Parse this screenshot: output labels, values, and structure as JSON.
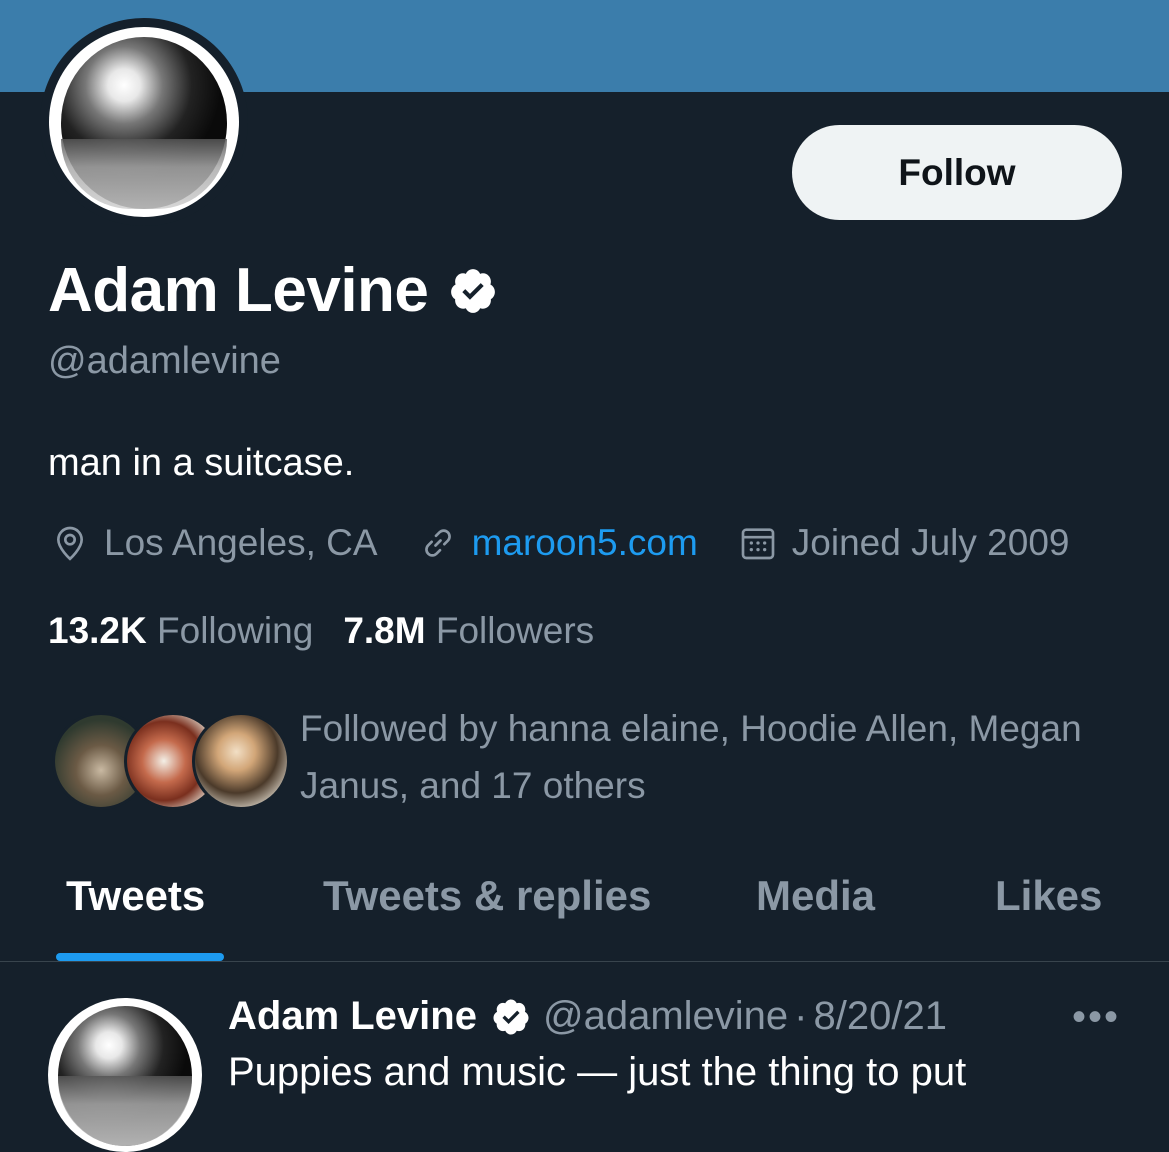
{
  "profile": {
    "name": "Adam Levine",
    "handle": "@adamlevine",
    "bio": "man in a suitcase.",
    "location": "Los Angeles, CA",
    "website": "maroon5.com",
    "joined": "Joined July 2009",
    "following_count": "13.2K",
    "following_label": "Following",
    "followers_count": "7.8M",
    "followers_label": "Followers",
    "followed_by_line1": "Followed by hanna elaine, Hoodie Allen, Megan",
    "followed_by_line2": "Janus, and 17 others"
  },
  "actions": {
    "follow_label": "Follow"
  },
  "tabs": [
    {
      "label": "Tweets"
    },
    {
      "label": "Tweets & replies"
    },
    {
      "label": "Media"
    },
    {
      "label": "Likes"
    }
  ],
  "tweet": {
    "name": "Adam Levine",
    "handle": "@adamlevine",
    "separator": "·",
    "date": "8/20/21",
    "more": "•••",
    "text": "Puppies and music — just the thing to put"
  },
  "colors": {
    "background": "#15202b",
    "banner": "#3b7dab",
    "accent": "#1d9bf0",
    "muted": "#8b98a5"
  },
  "icons": [
    "verified-badge-icon",
    "location-pin-icon",
    "link-icon",
    "calendar-icon",
    "more-icon"
  ]
}
